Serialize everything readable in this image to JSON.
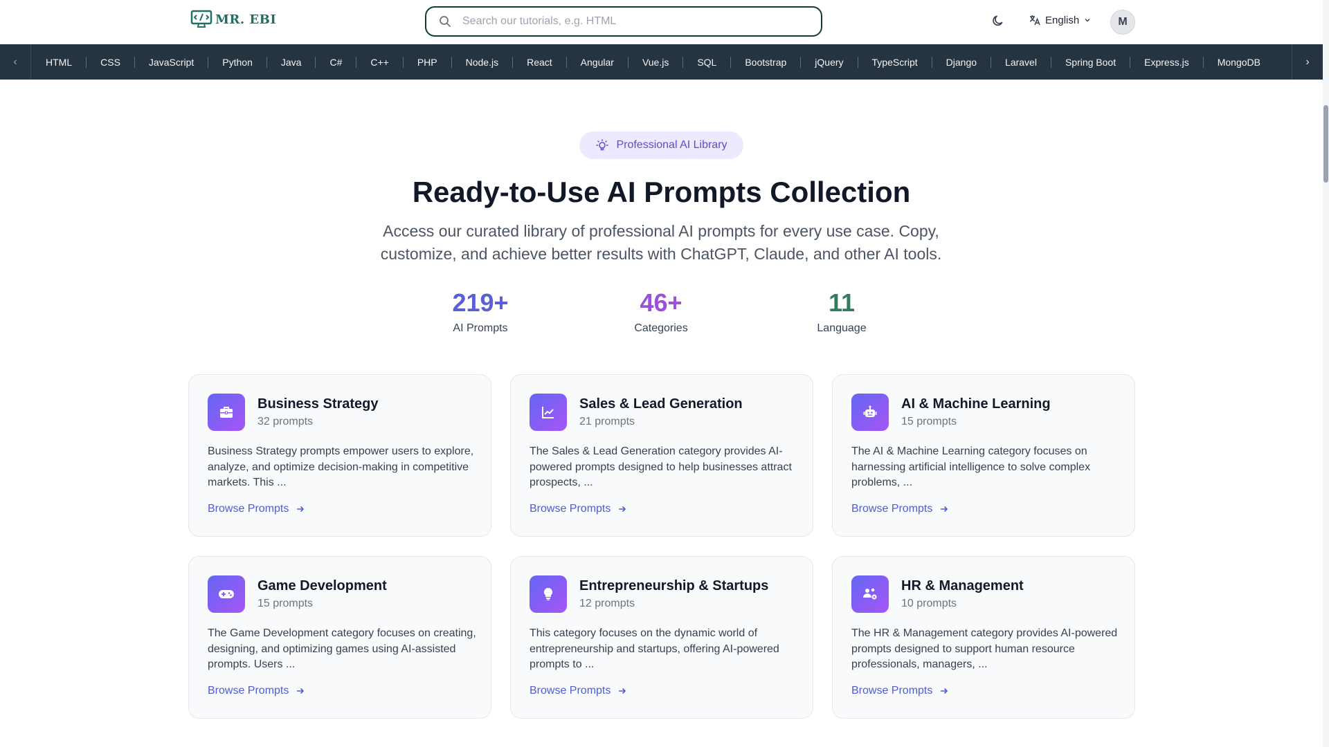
{
  "header": {
    "logo_text": "MR. EBI",
    "search_placeholder": "Search our tutorials, e.g. HTML",
    "language": "English",
    "avatar_initial": "M"
  },
  "nav": {
    "items": [
      "HTML",
      "CSS",
      "JavaScript",
      "Python",
      "Java",
      "C#",
      "C++",
      "PHP",
      "Node.js",
      "React",
      "Angular",
      "Vue.js",
      "SQL",
      "Bootstrap",
      "jQuery",
      "TypeScript",
      "Django",
      "Laravel",
      "Spring Boot",
      "Express.js",
      "MongoDB"
    ]
  },
  "hero": {
    "badge": "Professional AI Library",
    "title": "Ready-to-Use AI Prompts Collection",
    "subtitle": "Access our curated library of professional AI prompts for every use case. Copy, customize, and achieve better results with ChatGPT, Claude, and other AI tools."
  },
  "stats": [
    {
      "value": "219+",
      "label": "AI Prompts",
      "color": "#5b5fd6"
    },
    {
      "value": "46+",
      "label": "Categories",
      "color": "#9b51d6"
    },
    {
      "value": "11",
      "label": "Language",
      "color": "#2f7d5a"
    }
  ],
  "cards": [
    {
      "title": "Business Strategy",
      "count": "32 prompts",
      "desc": "Business Strategy prompts empower users to explore, analyze, and optimize decision-making in competitive markets. This ...",
      "link": "Browse Prompts",
      "icon": "briefcase-icon"
    },
    {
      "title": "Sales & Lead Generation",
      "count": "21 prompts",
      "desc": "The Sales & Lead Generation category provides AI-powered prompts designed to help businesses attract prospects, ...",
      "link": "Browse Prompts",
      "icon": "chart-line-icon"
    },
    {
      "title": "AI & Machine Learning",
      "count": "15 prompts",
      "desc": "The AI & Machine Learning category focuses on harnessing artificial intelligence to solve complex problems, ...",
      "link": "Browse Prompts",
      "icon": "robot-icon"
    },
    {
      "title": "Game Development",
      "count": "15 prompts",
      "desc": "The Game Development category focuses on creating, designing, and optimizing games using AI-assisted prompts. Users ...",
      "link": "Browse Prompts",
      "icon": "gamepad-icon"
    },
    {
      "title": "Entrepreneurship & Startups",
      "count": "12 prompts",
      "desc": "This category focuses on the dynamic world of entrepreneurship and startups, offering AI-powered prompts to ...",
      "link": "Browse Prompts",
      "icon": "lightbulb-icon"
    },
    {
      "title": "HR & Management",
      "count": "10 prompts",
      "desc": "The HR & Management category provides AI-powered prompts designed to support human resource professionals, managers, ...",
      "link": "Browse Prompts",
      "icon": "users-cog-icon"
    }
  ]
}
